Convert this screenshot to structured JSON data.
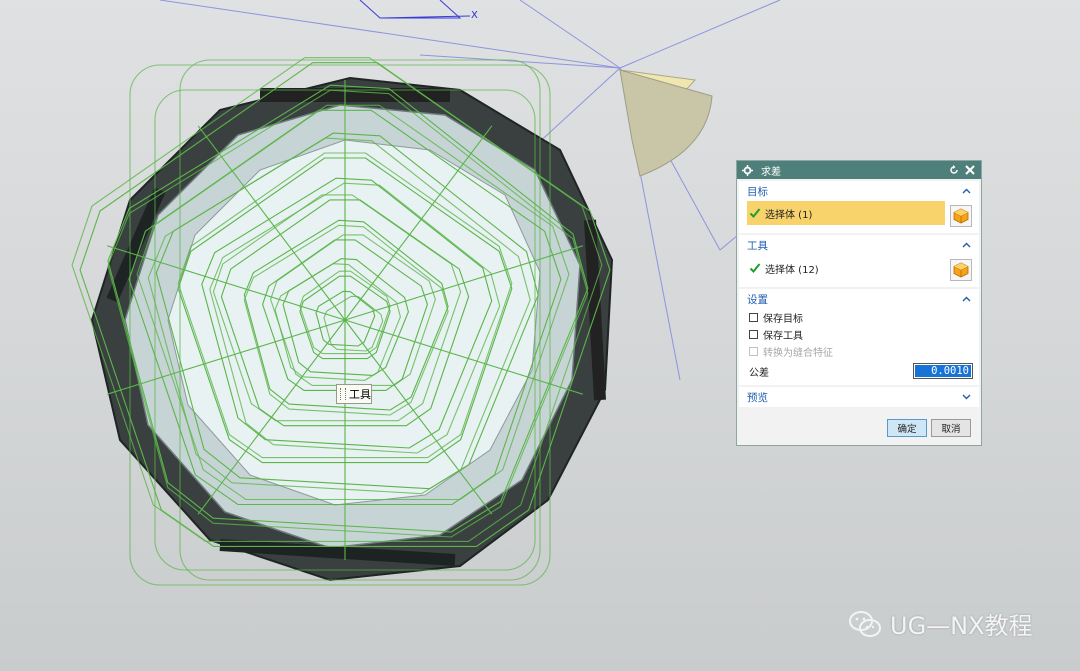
{
  "viewport": {
    "axis_label": "X",
    "tooltip_label": "工具"
  },
  "dialog": {
    "title": "求差",
    "target": {
      "header": "目标",
      "selection": "选择体 (1)"
    },
    "tool": {
      "header": "工具",
      "selection": "选择体 (12)"
    },
    "settings": {
      "header": "设置",
      "keep_target": "保存目标",
      "keep_tool": "保存工具",
      "convert_feature": "转换为缝合特征",
      "tolerance_label": "公差",
      "tolerance_value": "0.0010"
    },
    "preview": {
      "header": "预览"
    },
    "ok_label": "确定",
    "cancel_label": "取消"
  },
  "watermark": {
    "text": "UG—NX教程"
  },
  "colors": {
    "dialog_title_bar": "#4f7f7a",
    "active_selection": "#f8d36b",
    "section_header": "#1f5fb0",
    "wireframe": "#5bb54a",
    "solid": "#2f3737"
  }
}
